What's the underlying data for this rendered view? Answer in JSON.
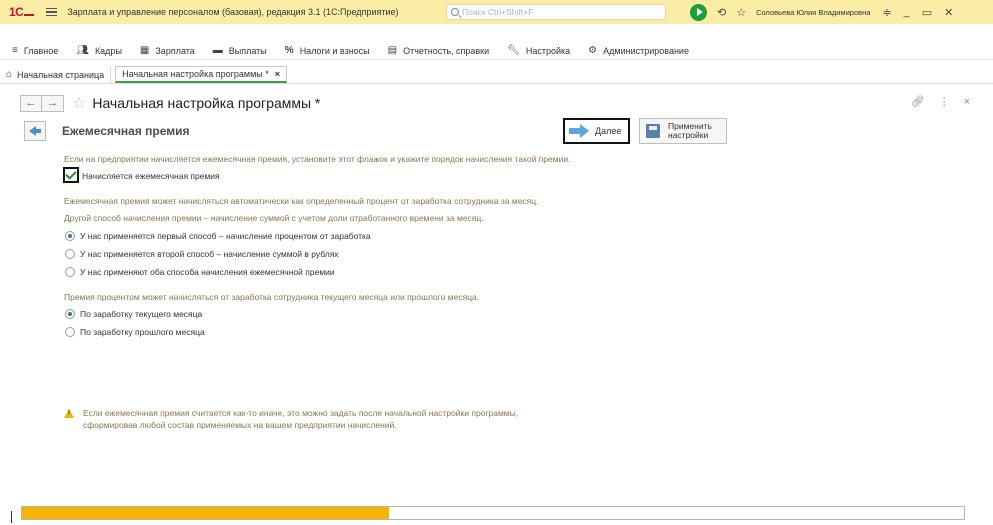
{
  "titlebar": {
    "logo": "1С",
    "app_title": "Зарплата и управление персоналом (базовая), редакция 3.1  (1С:Предприятие)",
    "search_placeholder": "Поиск Ctrl+Shift+F",
    "user": "Соловьева Юлия Владимировна"
  },
  "menu": [
    {
      "label": "Главное",
      "icon": "hamburger-icon"
    },
    {
      "label": "Кадры",
      "icon": "people-icon"
    },
    {
      "label": "Зарплата",
      "icon": "calculator-icon"
    },
    {
      "label": "Выплаты",
      "icon": "wallet-icon"
    },
    {
      "label": "Налоги и взносы",
      "icon": "percent-icon"
    },
    {
      "label": "Отчетность, справки",
      "icon": "report-icon"
    },
    {
      "label": "Настройка",
      "icon": "wrench-icon"
    },
    {
      "label": "Администрирование",
      "icon": "gear-icon"
    }
  ],
  "tabs": {
    "home": "Начальная страница",
    "active": "Начальная настройка программы *"
  },
  "form": {
    "title": "Начальная настройка программы *"
  },
  "step": {
    "title": "Ежемесячная премия",
    "next_label": "Далее",
    "apply_label_1": "Применить",
    "apply_label_2": "настройки"
  },
  "content": {
    "intro": "Если на предприятии начисляется ежемесячная премия, установите этот флажок и укажите порядок начисления такой премии.",
    "checkbox_label": "Начисляется ежемесячная премия",
    "checkbox_checked": true,
    "method_note_1": "Ежемесячная премия может начисляться автоматически как определенный процент от заработка сотрудника за месяц.",
    "method_note_2": "Другой способ начисления премии – начисление суммой с учетом доли отработанного времени за месяц.",
    "method_options": [
      {
        "label": "У нас применяется первый способ – начисление процентом от заработка",
        "selected": true
      },
      {
        "label": "У нас применяется второй способ – начисление суммой в рублях",
        "selected": false
      },
      {
        "label": "У нас применяют оба способа начисления ежемесячной премии",
        "selected": false
      }
    ],
    "base_note": "Премия процентом может начисляться от заработка сотрудника текущего месяца или прошлого месяца.",
    "base_options": [
      {
        "label": "По заработку текущего месяца",
        "selected": true
      },
      {
        "label": "По заработку прошлого месяца",
        "selected": false
      }
    ],
    "warning_1": "Если ежемесячная премия считается как-то иначе, это можно задать после начальной настройки программы,",
    "warning_2": "сформировав любой состав применяемых на вашем предприятии начислений."
  },
  "progress": {
    "fraction": 0.39,
    "color": "#f4b400"
  }
}
